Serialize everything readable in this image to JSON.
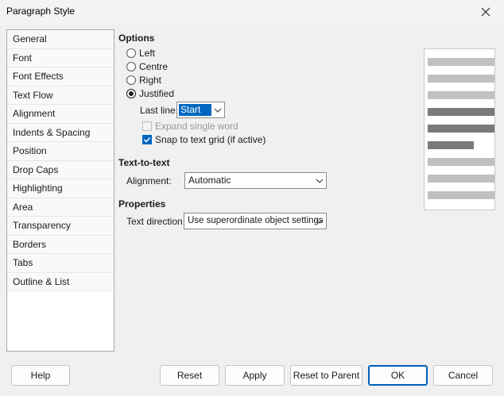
{
  "window": {
    "title": "Paragraph Style"
  },
  "sidebar": {
    "items": [
      {
        "label": "General"
      },
      {
        "label": "Font"
      },
      {
        "label": "Font Effects"
      },
      {
        "label": "Text Flow"
      },
      {
        "label": "Alignment"
      },
      {
        "label": "Indents & Spacing"
      },
      {
        "label": "Position"
      },
      {
        "label": "Drop Caps"
      },
      {
        "label": "Highlighting"
      },
      {
        "label": "Area"
      },
      {
        "label": "Transparency"
      },
      {
        "label": "Borders"
      },
      {
        "label": "Tabs"
      },
      {
        "label": "Outline & List"
      }
    ],
    "selected_index": 4
  },
  "options": {
    "heading": "Options",
    "radios": [
      {
        "label": "Left",
        "checked": false
      },
      {
        "label": "Centre",
        "checked": false
      },
      {
        "label": "Right",
        "checked": false
      },
      {
        "label": "Justified",
        "checked": true
      }
    ],
    "last_line": {
      "label": "Last line:",
      "value": "Start"
    },
    "expand_single_word": {
      "label": "Expand single word",
      "checked": false,
      "disabled": true
    },
    "snap_to_grid": {
      "label": "Snap to text grid (if active)",
      "checked": true
    }
  },
  "text_to_text": {
    "heading": "Text-to-text",
    "alignment": {
      "label": "Alignment:",
      "value": "Automatic"
    }
  },
  "properties": {
    "heading": "Properties",
    "text_direction": {
      "label": "Text direction:",
      "value": "Use superordinate object settings"
    }
  },
  "buttons": {
    "help": "Help",
    "reset": "Reset",
    "apply": "Apply",
    "reset_to_parent": "Reset to Parent",
    "ok": "OK",
    "cancel": "Cancel"
  },
  "colors": {
    "accent": "#0067c0"
  }
}
